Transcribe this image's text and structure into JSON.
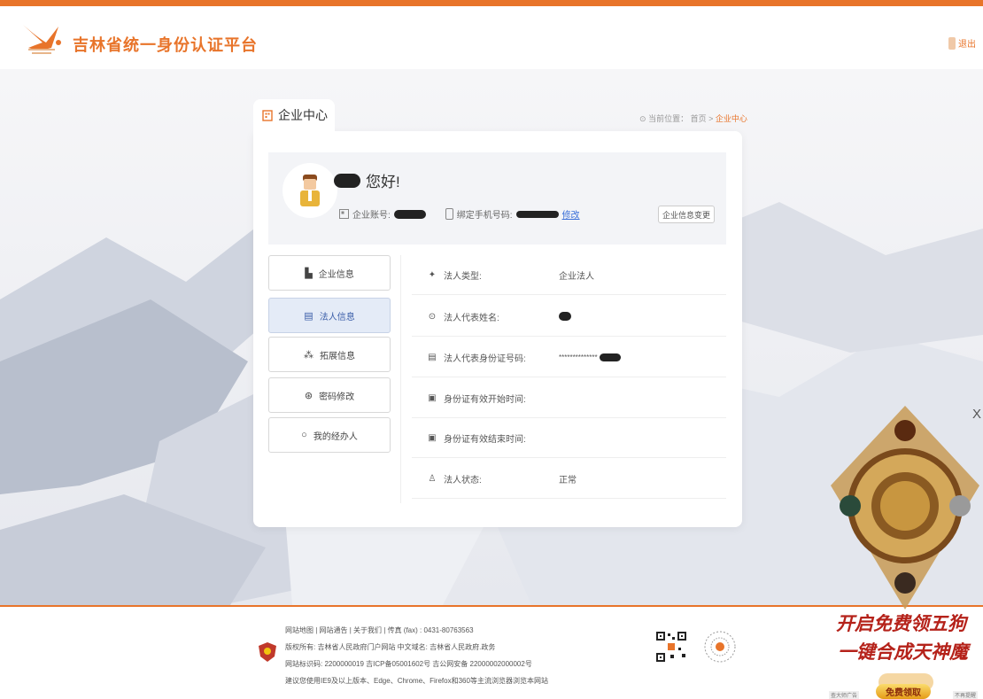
{
  "header": {
    "site_title": "吉林省统一身份认证平台",
    "logout_label": "退出"
  },
  "tab": {
    "label": "企业中心"
  },
  "breadcrumb": {
    "prefix": "当前位置：",
    "home": "首页",
    "separator": ">",
    "current": "企业中心"
  },
  "profile": {
    "greeting": "您好!",
    "account_label": "企业账号:",
    "phone_label": "绑定手机号码:",
    "edit_link": "修改",
    "change_button": "企业信息变更"
  },
  "menu": {
    "items": [
      {
        "label": "企业信息",
        "icon": "building-icon",
        "active": false
      },
      {
        "label": "法人信息",
        "icon": "id-card-icon",
        "active": true
      },
      {
        "label": "拓展信息",
        "icon": "share-icon",
        "active": false
      },
      {
        "label": "密码修改",
        "icon": "lock-icon",
        "active": false
      },
      {
        "label": "我的经办人",
        "icon": "user-circle-icon",
        "active": false
      }
    ]
  },
  "details": {
    "rows": [
      {
        "label": "法人类型:",
        "value": "企业法人",
        "icon": "pin-icon"
      },
      {
        "label": "法人代表姓名:",
        "value": "",
        "icon": "person-icon"
      },
      {
        "label": "法人代表身份证号码:",
        "value": "**************",
        "icon": "id-card-icon"
      },
      {
        "label": "身份证有效开始时间:",
        "value": "",
        "icon": "calendar-icon"
      },
      {
        "label": "身份证有效结束时间:",
        "value": "",
        "icon": "calendar-icon"
      },
      {
        "label": "法人状态:",
        "value": "正常",
        "icon": "user-status-icon"
      }
    ]
  },
  "footer": {
    "line1": "网站地图  |  网站通告  |  关于我们  |   传真 (fax) : 0431-80763563",
    "line2": "版权所有: 吉林省人民政府门户网站    中文域名: 吉林省人民政府.政务",
    "line3": "网站标识码: 2200000019    吉ICP备05001602号     吉公网安备 22000002000002号",
    "line4": "建议您使用IE9及以上版本、Edge、Chrome、Firefox和360等主流浏览器浏览本网站"
  },
  "ad": {
    "line1": "开启免费领五狗",
    "line2": "一键合成天神魔",
    "button": "免费领取",
    "tag_left": "查大师广告",
    "tag_right": "不再提醒",
    "close": "X"
  },
  "colors": {
    "accent": "#e8742a",
    "link": "#3a6fd8",
    "active_menu_bg": "#e4ebf7"
  }
}
